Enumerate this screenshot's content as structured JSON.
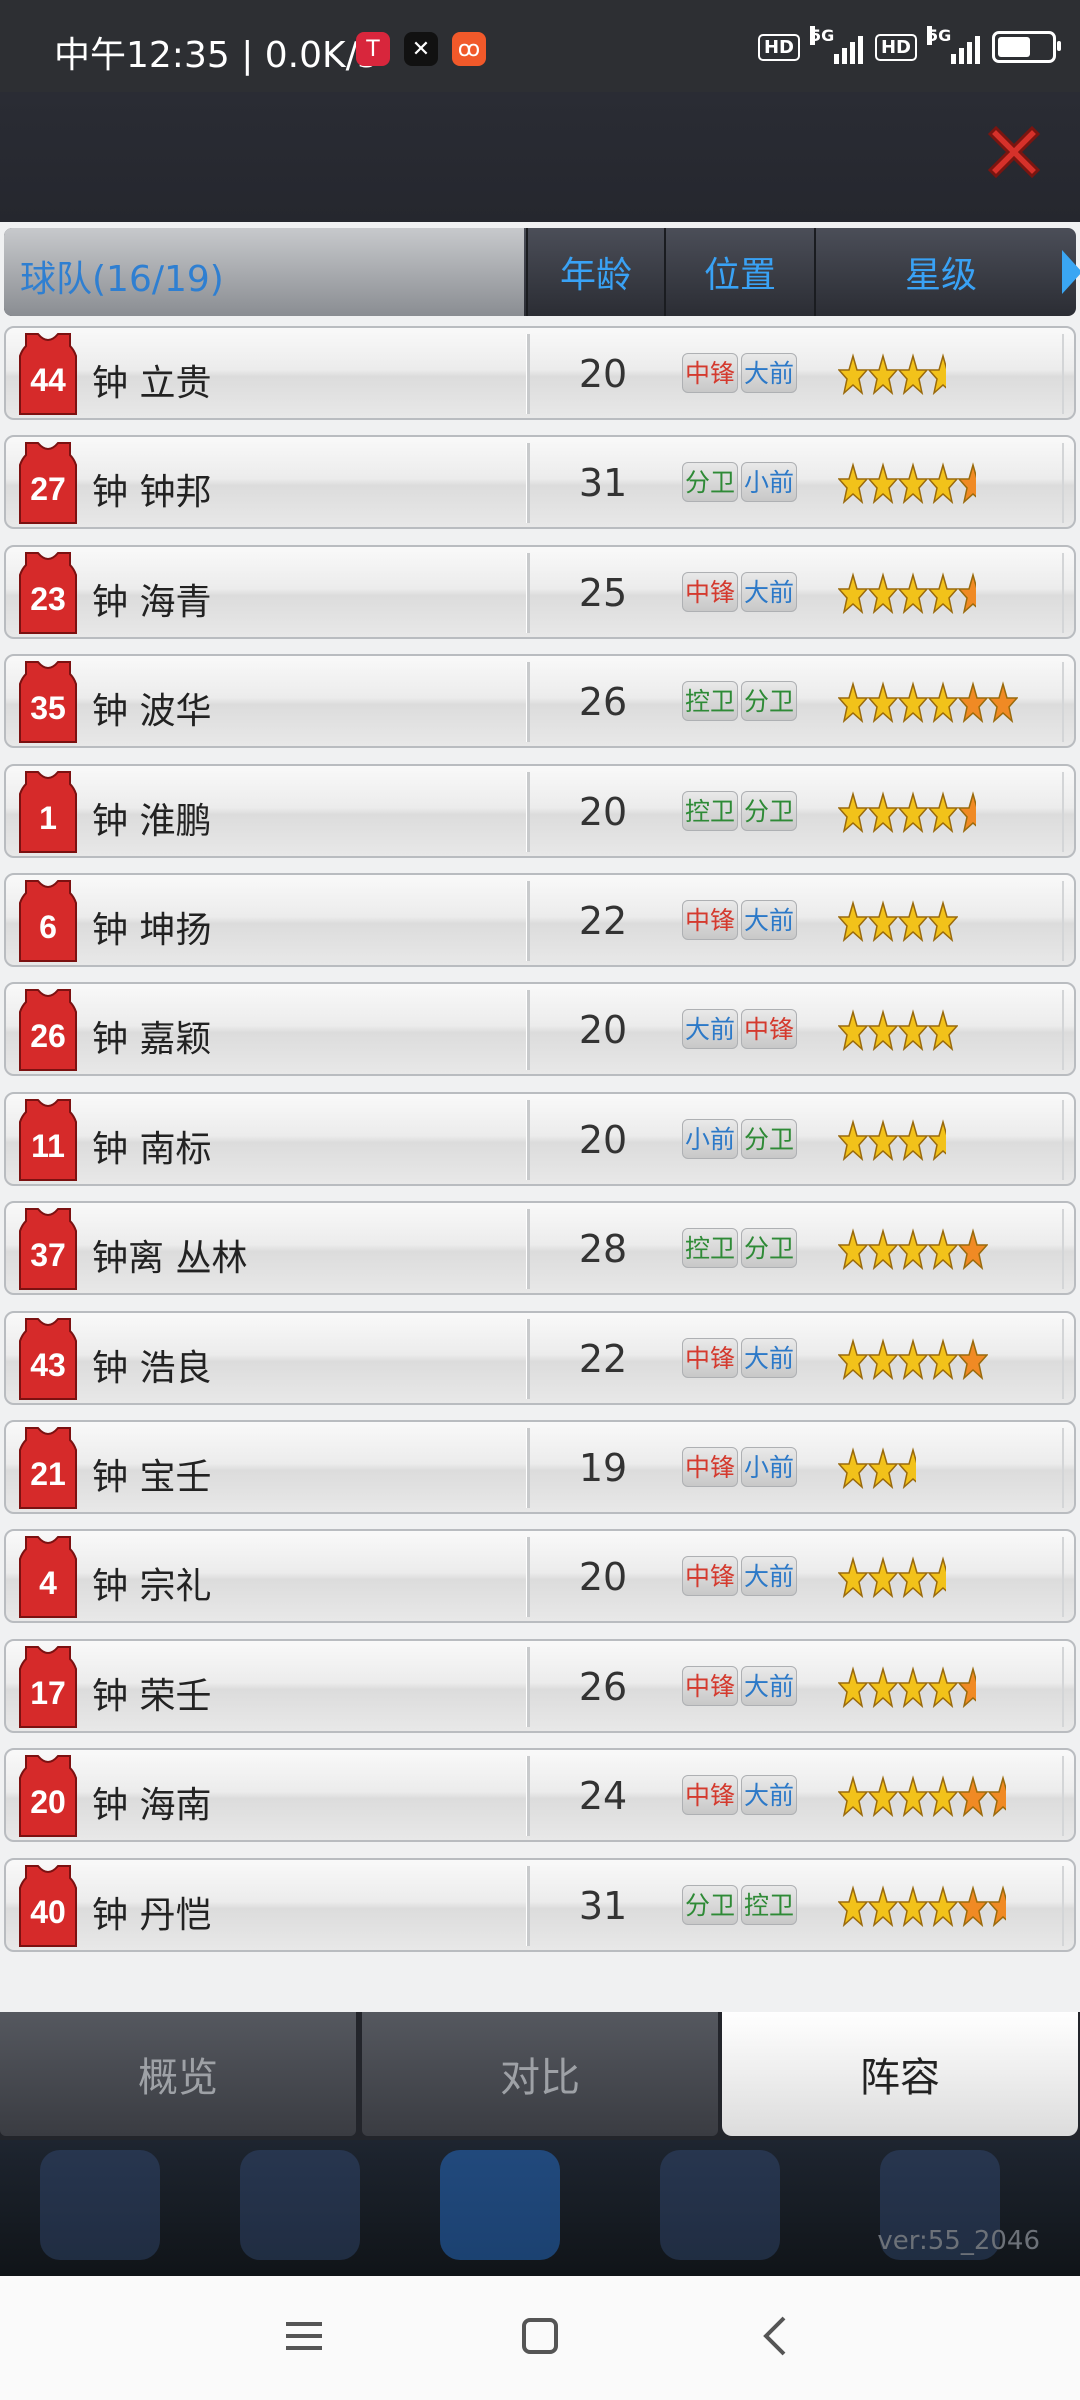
{
  "status_bar": {
    "time_speed": "中午12:35 | 0.0K/s",
    "network_1": "5G",
    "network_2": "5G",
    "hd_1": "HD",
    "hd_2": "HD",
    "battery_level": 0.6
  },
  "header": {
    "close_icon": "close-x-icon"
  },
  "columns": {
    "team": "球队(16/19)",
    "age": "年龄",
    "position": "位置",
    "stars": "星级"
  },
  "players": [
    {
      "number": "44",
      "name": "钟 立贵",
      "age": "20",
      "pos": [
        {
          "t": "中锋",
          "c": "red"
        },
        {
          "t": "大前",
          "c": "blue"
        }
      ],
      "stars": 3.5
    },
    {
      "number": "27",
      "name": "钟 钟邦",
      "age": "31",
      "pos": [
        {
          "t": "分卫",
          "c": "green"
        },
        {
          "t": "小前",
          "c": "blue"
        }
      ],
      "stars": 4.5
    },
    {
      "number": "23",
      "name": "钟 海青",
      "age": "25",
      "pos": [
        {
          "t": "中锋",
          "c": "red"
        },
        {
          "t": "大前",
          "c": "blue"
        }
      ],
      "stars": 4.5
    },
    {
      "number": "35",
      "name": "钟 波华",
      "age": "26",
      "pos": [
        {
          "t": "控卫",
          "c": "green"
        },
        {
          "t": "分卫",
          "c": "green"
        }
      ],
      "stars": 6
    },
    {
      "number": "1",
      "name": "钟 淮鹏",
      "age": "20",
      "pos": [
        {
          "t": "控卫",
          "c": "green"
        },
        {
          "t": "分卫",
          "c": "green"
        }
      ],
      "stars": 4.5
    },
    {
      "number": "6",
      "name": "钟 坤扬",
      "age": "22",
      "pos": [
        {
          "t": "中锋",
          "c": "red"
        },
        {
          "t": "大前",
          "c": "blue"
        }
      ],
      "stars": 4
    },
    {
      "number": "26",
      "name": "钟 嘉颖",
      "age": "20",
      "pos": [
        {
          "t": "大前",
          "c": "blue"
        },
        {
          "t": "中锋",
          "c": "red"
        }
      ],
      "stars": 4
    },
    {
      "number": "11",
      "name": "钟 南标",
      "age": "20",
      "pos": [
        {
          "t": "小前",
          "c": "blue"
        },
        {
          "t": "分卫",
          "c": "green"
        }
      ],
      "stars": 3.5
    },
    {
      "number": "37",
      "name": "钟离 丛林",
      "age": "28",
      "pos": [
        {
          "t": "控卫",
          "c": "green"
        },
        {
          "t": "分卫",
          "c": "green"
        }
      ],
      "stars": 5
    },
    {
      "number": "43",
      "name": "钟 浩良",
      "age": "22",
      "pos": [
        {
          "t": "中锋",
          "c": "red"
        },
        {
          "t": "大前",
          "c": "blue"
        }
      ],
      "stars": 5
    },
    {
      "number": "21",
      "name": "钟 宝壬",
      "age": "19",
      "pos": [
        {
          "t": "中锋",
          "c": "red"
        },
        {
          "t": "小前",
          "c": "blue"
        }
      ],
      "stars": 2.5
    },
    {
      "number": "4",
      "name": "钟 宗礼",
      "age": "20",
      "pos": [
        {
          "t": "中锋",
          "c": "red"
        },
        {
          "t": "大前",
          "c": "blue"
        }
      ],
      "stars": 3.5
    },
    {
      "number": "17",
      "name": "钟 荣壬",
      "age": "26",
      "pos": [
        {
          "t": "中锋",
          "c": "red"
        },
        {
          "t": "大前",
          "c": "blue"
        }
      ],
      "stars": 4.5
    },
    {
      "number": "20",
      "name": "钟 海南",
      "age": "24",
      "pos": [
        {
          "t": "中锋",
          "c": "red"
        },
        {
          "t": "大前",
          "c": "blue"
        }
      ],
      "stars": 5.5
    },
    {
      "number": "40",
      "name": "钟 丹恺",
      "age": "31",
      "pos": [
        {
          "t": "分卫",
          "c": "green"
        },
        {
          "t": "控卫",
          "c": "green"
        }
      ],
      "stars": 5.5
    }
  ],
  "tabs": [
    {
      "label": "概览",
      "active": false
    },
    {
      "label": "对比",
      "active": false
    },
    {
      "label": "阵容",
      "active": true
    }
  ],
  "version": "ver:55_2046",
  "nav_icons": [
    "menu-icon",
    "home-icon",
    "back-icon"
  ]
}
